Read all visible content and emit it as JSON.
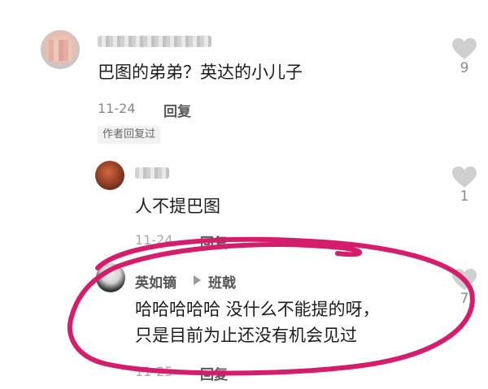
{
  "comments": [
    {
      "text": "巴图的弟弟？英达的小儿子",
      "date": "11-24",
      "reply_label": "回复",
      "likes": "9",
      "author_tag": "作者回复过"
    },
    {
      "text": "人不提巴图",
      "date": "11-24",
      "reply_label": "回复",
      "likes": "1"
    },
    {
      "username": "英如镝",
      "reply_to": "班戟",
      "text_line1": "哈哈哈哈哈 没什么不能提的呀，",
      "text_line2": "只是目前为止还没有机会见过",
      "date": "11-25",
      "reply_label": "回复",
      "likes": "7"
    }
  ],
  "colors": {
    "highlight_circle": "#d41e6b",
    "like_icon": "#cfcfcf"
  }
}
